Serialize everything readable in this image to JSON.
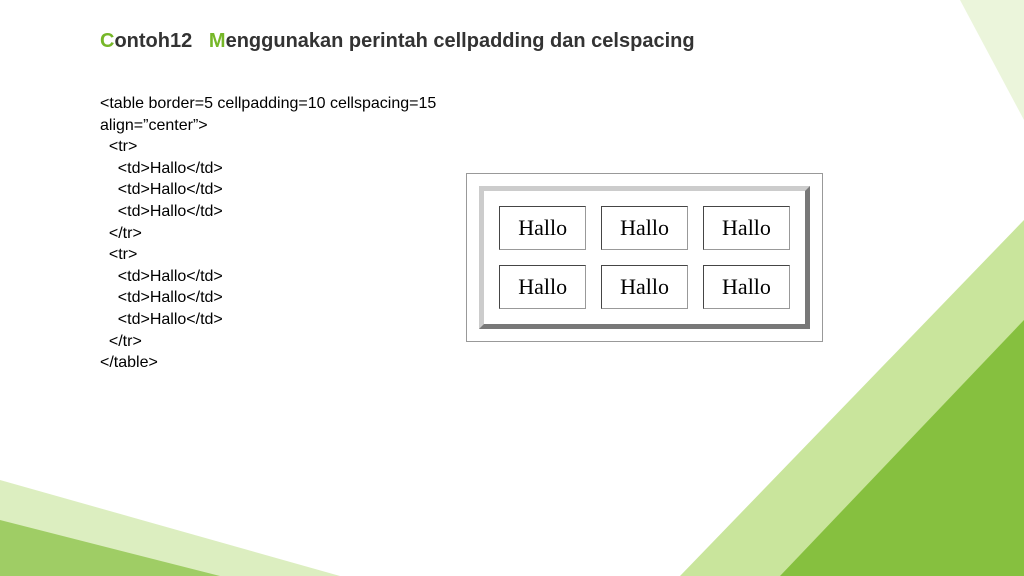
{
  "title_accent1": "C",
  "title_part1": "ontoh12   ",
  "title_accent2": "M",
  "title_part2": "enggunakan perintah cellpadding dan celspacing",
  "code": {
    "l1": "<table border=5 cellpadding=10 cellspacing=15",
    "l2": "align=”center”>",
    "l3": "  <tr>",
    "l4": "    <td>Hallo</td>",
    "l5": "    <td>Hallo</td>",
    "l6": "    <td>Hallo</td>",
    "l7": "  </tr>",
    "l8": "  <tr>",
    "l9": "    <td>Hallo</td>",
    "l10": "    <td>Hallo</td>",
    "l11": "    <td>Hallo</td>",
    "l12": "  </tr>",
    "l13": "</table>"
  },
  "cells": {
    "r0c0": "Hallo",
    "r0c1": "Hallo",
    "r0c2": "Hallo",
    "r1c0": "Hallo",
    "r1c1": "Hallo",
    "r1c2": "Hallo"
  }
}
